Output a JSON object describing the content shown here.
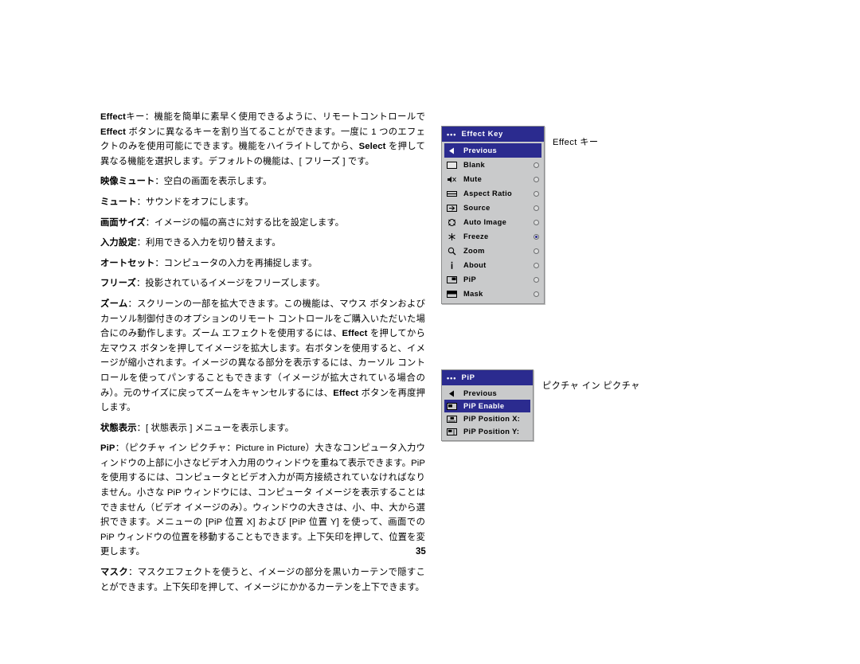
{
  "document": {
    "page_number": "35",
    "paragraphs": [
      {
        "id": "p_effect_key",
        "html": "<span class=\"b\">Effect</span>キー：機能を簡単に素早く使用できるように、リモートコントロールで<span class=\"b\">Effect</span> ボタンに異なるキーを割り当てることができます。一度に 1 つのエフェクトのみを使用可能にできます。機能をハイライトしてから、<span class=\"b\">Select</span> を押して異なる機能を選択します。デフォルトの機能は、[ フリーズ ] です。"
      },
      {
        "id": "p_blank",
        "html": "<span class=\"b\">映像ミュート</span>：空白の画面を表示します。"
      },
      {
        "id": "p_mute",
        "html": "<span class=\"b\">ミュート</span>：サウンドをオフにします。"
      },
      {
        "id": "p_aspect",
        "html": "<span class=\"b\">画面サイズ</span>：イメージの幅の高さに対する比を設定します。"
      },
      {
        "id": "p_source",
        "html": "<span class=\"b\">入力設定</span>：利用できる入力を切り替えます。"
      },
      {
        "id": "p_autoimage",
        "html": "<span class=\"b\">オートセット</span>：コンピュータの入力を再捕捉します。"
      },
      {
        "id": "p_freeze",
        "html": "<span class=\"b\">フリーズ</span>：投影されているイメージをフリーズします。"
      },
      {
        "id": "p_zoom",
        "html": "<span class=\"b\">ズーム</span>：スクリーンの一部を拡大できます。この機能は、マウス ボタンおよびカーソル制御付きのオプションのリモート コントロールをご購入いただいた場合にのみ動作します。ズーム エフェクトを使用するには、<span class=\"b\">Effect</span> を押してから左マウス ボタンを押してイメージを拡大します。右ボタンを使用すると、イメージが縮小されます。イメージの異なる部分を表示するには、カーソル コントロールを使ってパンすることもできます（イメージが拡大されている場合のみ）。元のサイズに戻ってズームをキャンセルするには、<span class=\"b\">Effect</span> ボタンを再度押します。"
      },
      {
        "id": "p_about",
        "html": "<span class=\"b\">状態表示</span>：[ 状態表示 ] メニューを表示します。"
      },
      {
        "id": "p_pip",
        "html": "<span class=\"b\">PiP</span>：（ピクチャ イン ピクチャ：Picture in Picture）大きなコンピュータ入力ウィンドウの上部に小さなビデオ入力用のウィンドウを重ねて表示できます。PiP を使用するには、コンピュータとビデオ入力が両方接続されていなければなりません。小さな PiP ウィンドウには、コンピュータ イメージを表示することはできません（ビデオ イメージのみ）。ウィンドウの大きさは、小、中、大から選択できます。メニューの [PiP 位置 X] および [PiP 位置 Y] を使って、画面での PiP ウィンドウの位置を移動することもできます。上下矢印を押して、位置を変更します。"
      },
      {
        "id": "p_mask",
        "html": "<span class=\"b\">マスク</span>：マスクエフェクトを使うと、イメージの部分を黒いカーテンで隠すことができます。上下矢印を押して、イメージにかかるカーテンを上下できます。"
      }
    ]
  },
  "effect_key_menu": {
    "title": "Effect Key",
    "caption": "Effect キー",
    "title_dots": "•••",
    "items": [
      {
        "label": "Previous",
        "icon": "left-arrow-icon",
        "selected": true,
        "radio": false
      },
      {
        "label": "Blank",
        "icon": "blank-screen-icon",
        "selected": false,
        "radio": true,
        "checked": false
      },
      {
        "label": "Mute",
        "icon": "mute-speaker-icon",
        "selected": false,
        "radio": true,
        "checked": false
      },
      {
        "label": "Aspect Ratio",
        "icon": "aspect-ratio-icon",
        "selected": false,
        "radio": true,
        "checked": false
      },
      {
        "label": "Source",
        "icon": "source-arrow-icon",
        "selected": false,
        "radio": true,
        "checked": false
      },
      {
        "label": "Auto Image",
        "icon": "auto-image-icon",
        "selected": false,
        "radio": true,
        "checked": false
      },
      {
        "label": "Freeze",
        "icon": "freeze-snowflake-icon",
        "selected": false,
        "radio": true,
        "checked": true
      },
      {
        "label": "Zoom",
        "icon": "magnifier-icon",
        "selected": false,
        "radio": true,
        "checked": false
      },
      {
        "label": "About",
        "icon": "info-icon",
        "selected": false,
        "radio": true,
        "checked": false
      },
      {
        "label": "PiP",
        "icon": "pip-icon",
        "selected": false,
        "radio": true,
        "checked": false
      },
      {
        "label": "Mask",
        "icon": "mask-icon",
        "selected": false,
        "radio": true,
        "checked": false
      }
    ]
  },
  "pip_menu": {
    "title": "PiP",
    "caption": "ピクチャ イン ピクチャ",
    "title_dots": "•••",
    "items": [
      {
        "label": "Previous",
        "icon": "left-arrow-icon",
        "selected": false
      },
      {
        "label": "PiP Enable",
        "icon": "pip-enable-icon",
        "selected": true
      },
      {
        "label": "PiP Position X:",
        "icon": "pip-position-x-icon",
        "selected": false
      },
      {
        "label": "PiP Position Y:",
        "icon": "pip-position-y-icon",
        "selected": false
      }
    ]
  },
  "colors": {
    "menu_title_bg": "#2b2b8f",
    "menu_bg": "#c9cacb",
    "menu_border": "#8c8d8e"
  }
}
